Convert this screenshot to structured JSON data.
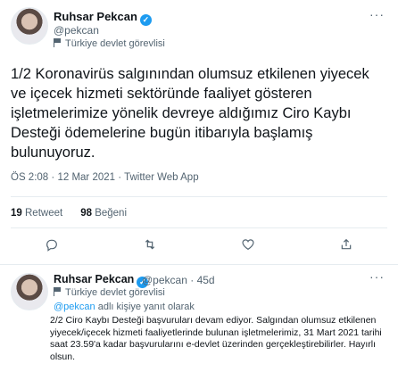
{
  "main_tweet": {
    "author_name": "Ruhsar Pekcan",
    "handle": "@pekcan",
    "label": "Türkiye devlet görevlisi",
    "text": "1/2 Koronavirüs salgınından olumsuz etkilenen yiyecek ve içecek hizmeti sektöründe faaliyet gösteren işletmelerimize yönelik devreye aldığımız Ciro Kaybı Desteği ödemelerine bugün itibarıyla başlamış bulunuyoruz.",
    "time": "ÖS 2:08",
    "date": "12 Mar 2021",
    "source": "Twitter Web App",
    "meta_sep": "·",
    "retweets_count": "19",
    "retweets_label": "Retweet",
    "likes_count": "98",
    "likes_label": "Beğeni",
    "more_icon": "more-horizontal-icon"
  },
  "actions": [
    "reply-icon",
    "retweet-icon",
    "like-icon",
    "share-icon"
  ],
  "reply_tweet": {
    "author_name": "Ruhsar Pekcan",
    "handle": "@pekcan",
    "age": "45d",
    "meta_sep": "·",
    "label": "Türkiye devlet görevlisi",
    "replying_to_handle": "@pekcan",
    "replying_suffix": "adlı kişiye yanıt olarak",
    "text": "2/2 Ciro Kaybı Desteği başvuruları devam ediyor. Salgından olumsuz etkilenen yiyecek/içecek hizmeti faaliyetlerinde bulunan işletmelerimiz, 31 Mart 2021 tarihi saat 23.59'a kadar başvurularını e-devlet üzerinden gerçekleştirebilirler. Hayırlı olsun."
  },
  "colors": {
    "accent": "#1d9bf0",
    "text": "#0f1419",
    "muted": "#536471",
    "divider": "#e6ecf0"
  }
}
